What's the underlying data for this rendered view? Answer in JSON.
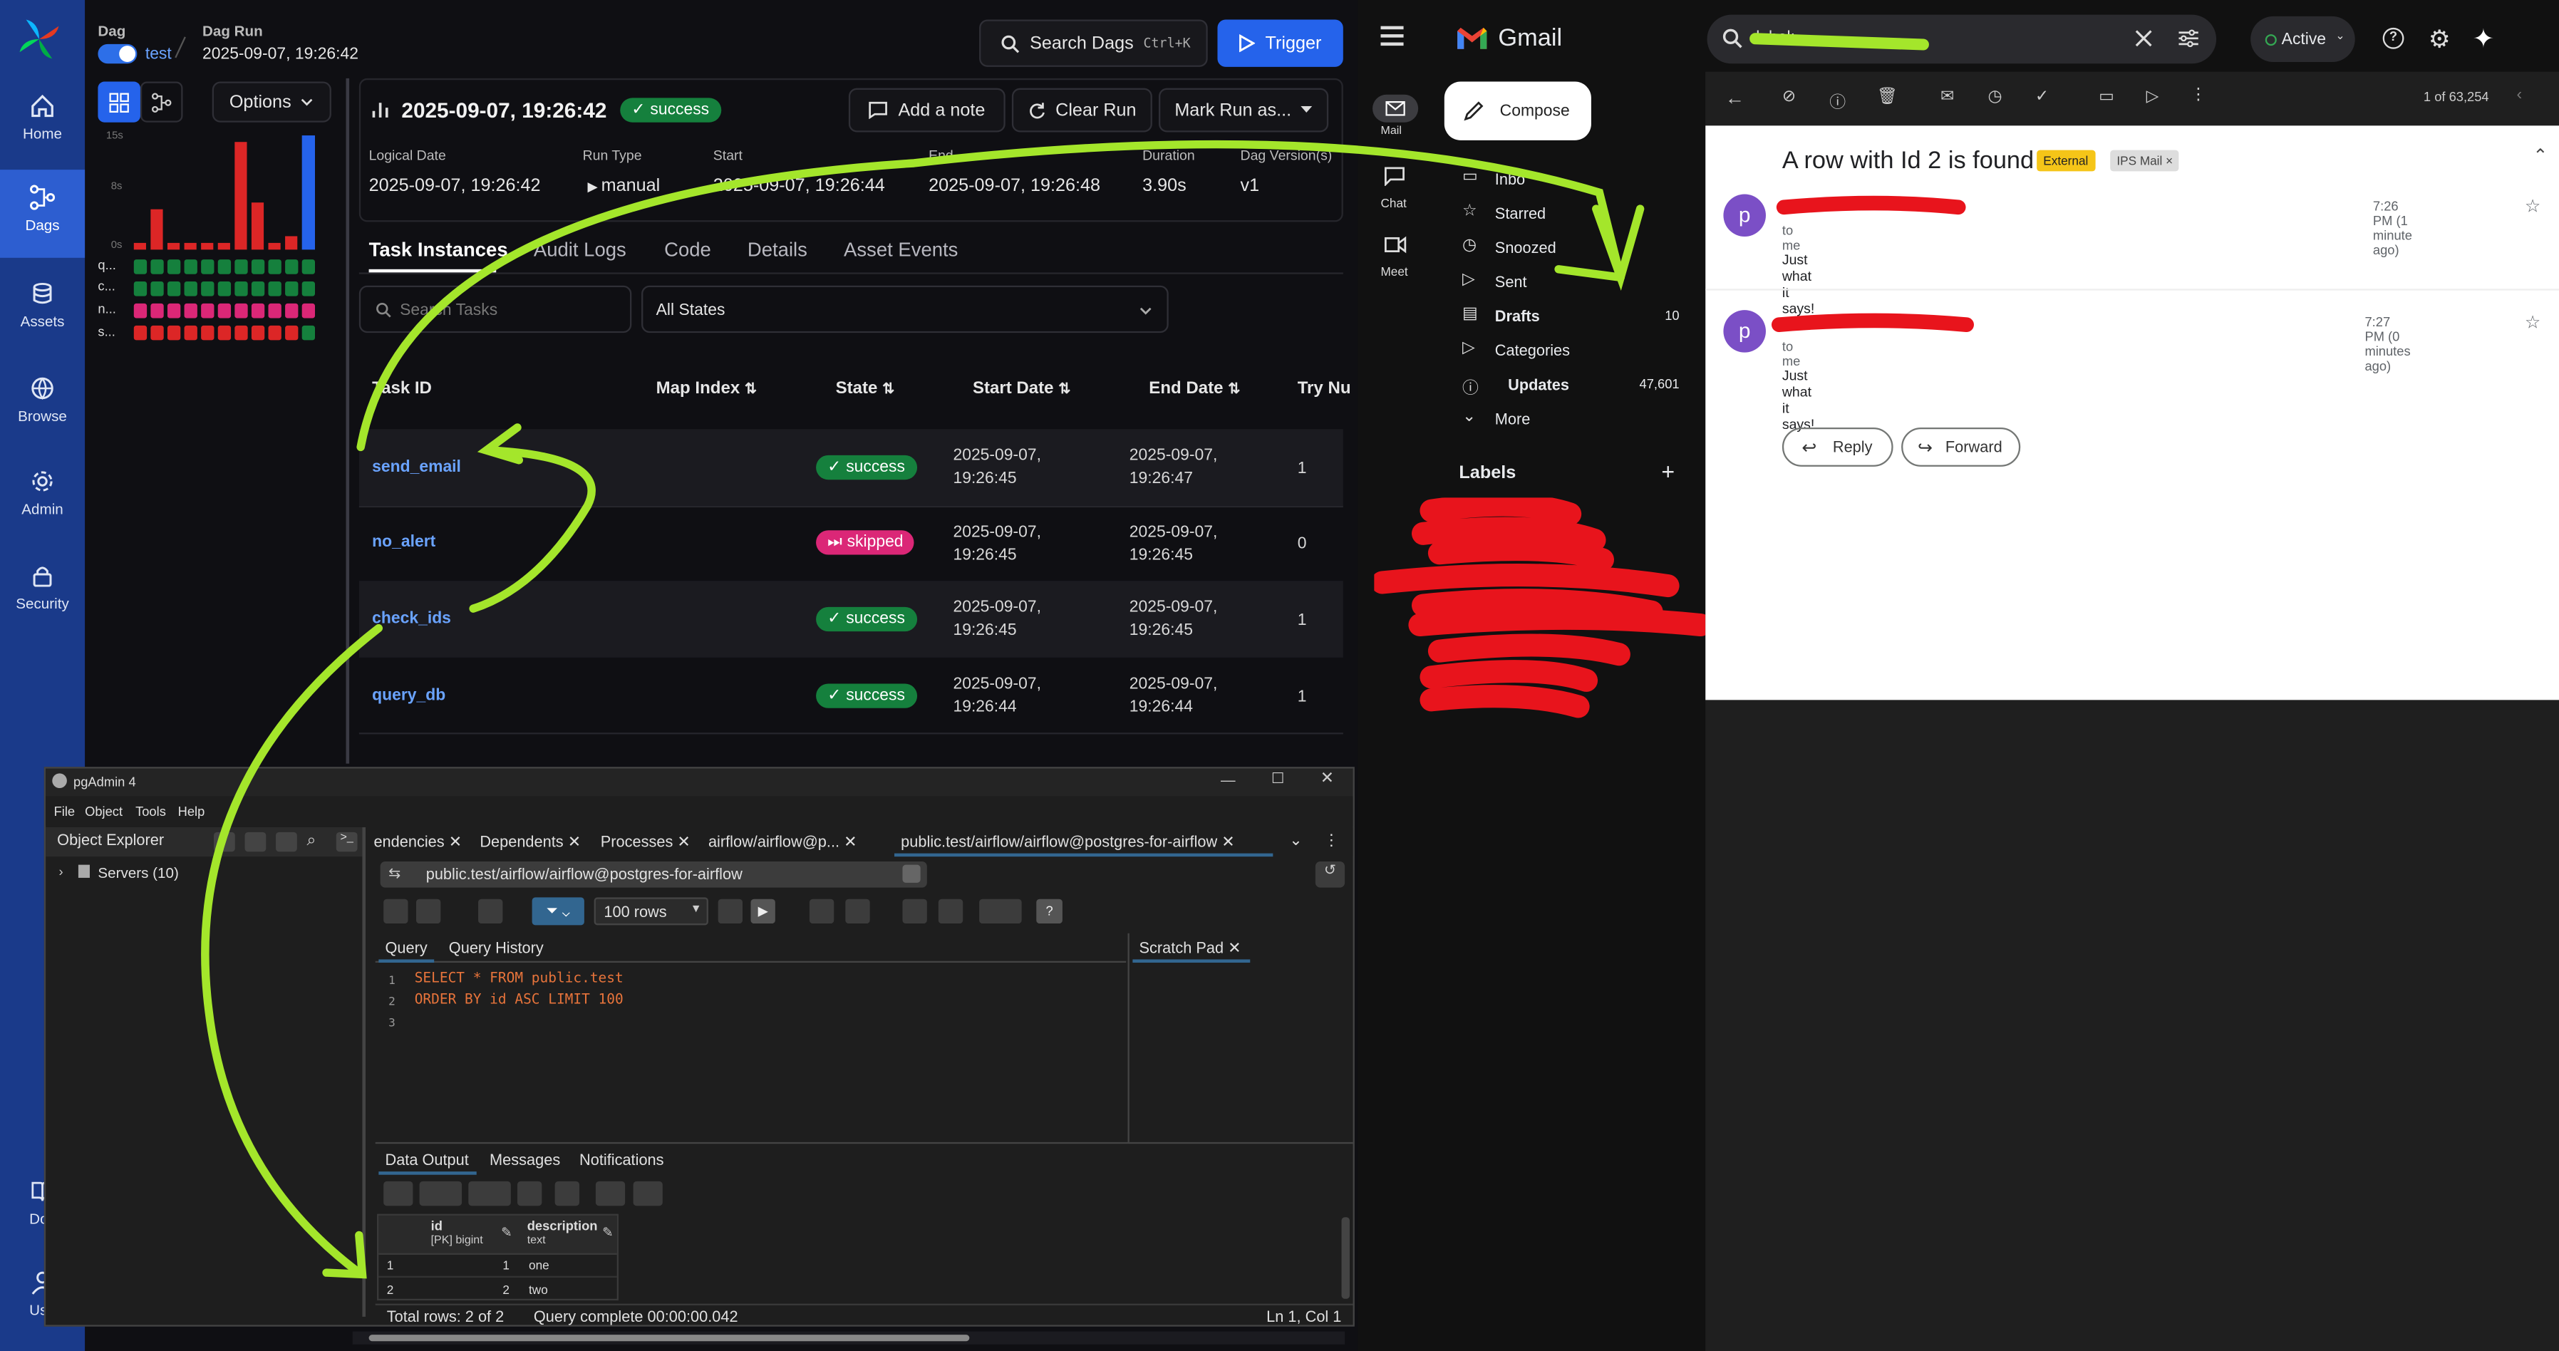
{
  "airflow": {
    "nav": [
      {
        "label": "Home",
        "icon": "home-icon"
      },
      {
        "label": "Dags",
        "icon": "dags-icon"
      },
      {
        "label": "Assets",
        "icon": "assets-icon"
      },
      {
        "label": "Browse",
        "icon": "browse-icon"
      },
      {
        "label": "Admin",
        "icon": "admin-icon"
      },
      {
        "label": "Security",
        "icon": "security-icon"
      },
      {
        "label": "Doc",
        "icon": "docs-icon"
      },
      {
        "label": "Use",
        "icon": "user-icon"
      }
    ],
    "breadcrumb": {
      "dag_label": "Dag",
      "dag_name": "test",
      "run_label": "Dag Run",
      "run_value": "2025-09-07, 19:26:42"
    },
    "search": {
      "label": "Search Dags",
      "shortcut": "Ctrl+K"
    },
    "trigger_label": "Trigger",
    "options_label": "Options",
    "grid": {
      "y_ticks": [
        "15s",
        "8s",
        "0s"
      ],
      "row_labels": [
        "q...",
        "c...",
        "n...",
        "s..."
      ],
      "bar_values": [
        1,
        6,
        1,
        1,
        1,
        1,
        16,
        7,
        1,
        2
      ],
      "accent_color": "#dc2626"
    },
    "run": {
      "title": "2025-09-07, 19:26:42",
      "status": "success",
      "add_note": "Add a note",
      "clear_run": "Clear Run",
      "mark_run": "Mark Run as...",
      "fields": [
        {
          "label": "Logical Date",
          "value": "2025-09-07, 19:26:42"
        },
        {
          "label": "Run Type",
          "value": "manual"
        },
        {
          "label": "Start",
          "value": "2025-09-07, 19:26:44"
        },
        {
          "label": "End",
          "value": "2025-09-07, 19:26:48"
        },
        {
          "label": "Duration",
          "value": "3.90s"
        },
        {
          "label": "Dag Version(s)",
          "value": "v1"
        }
      ]
    },
    "tabs": [
      "Task Instances",
      "Audit Logs",
      "Code",
      "Details",
      "Asset Events"
    ],
    "filter": {
      "search_placeholder": "Search Tasks",
      "state": "All States"
    },
    "columns": [
      "Task ID",
      "Map Index",
      "State",
      "Start Date",
      "End Date",
      "Try Nu"
    ],
    "tasks": [
      {
        "id": "send_email",
        "state": "success",
        "start": "2025-09-07,\n19:26:45",
        "end": "2025-09-07,\n19:26:47",
        "try": "1"
      },
      {
        "id": "no_alert",
        "state": "skipped",
        "start": "2025-09-07,\n19:26:45",
        "end": "2025-09-07,\n19:26:45",
        "try": "0"
      },
      {
        "id": "check_ids",
        "state": "success",
        "start": "2025-09-07,\n19:26:45",
        "end": "2025-09-07,\n19:26:45",
        "try": "1"
      },
      {
        "id": "query_db",
        "state": "success",
        "start": "2025-09-07,\n19:26:44",
        "end": "2025-09-07,\n19:26:44",
        "try": "1"
      }
    ]
  },
  "pgadmin": {
    "title": "pgAdmin 4",
    "menu": [
      "File",
      "Object",
      "Tools",
      "Help"
    ],
    "explorer_title": "Object Explorer",
    "tree_item": "Servers (10)",
    "tabs": [
      "endencies",
      "Dependents",
      "Processes",
      "airflow/airflow@p...",
      "public.test/airflow/airflow@postgres-for-airflow"
    ],
    "connection": "public.test/airflow/airflow@postgres-for-airflow",
    "rows_limit": "100 rows",
    "editor_tabs": [
      "Query",
      "Query History"
    ],
    "scratch_pad": "Scratch Pad",
    "query_lines": [
      "SELECT * FROM public.test",
      "ORDER BY id ASC LIMIT 100",
      ""
    ],
    "output_tabs": [
      "Data Output",
      "Messages",
      "Notifications"
    ],
    "columns": [
      {
        "name": "id",
        "type": "[PK] bigint"
      },
      {
        "name": "description",
        "type": "text"
      }
    ],
    "rows": [
      {
        "n": "1",
        "id": "1",
        "description": "one"
      },
      {
        "n": "2",
        "id": "2",
        "description": "two"
      }
    ],
    "status": {
      "total": "Total rows: 2 of 2",
      "complete": "Query complete 00:00:00.042",
      "position": "Ln 1, Col 1"
    }
  },
  "gmail": {
    "brand": "Gmail",
    "search_value": "label:",
    "status": "Active",
    "rail": [
      {
        "label": "Mail",
        "icon": "mail-icon"
      },
      {
        "label": "Chat",
        "icon": "chat-icon"
      },
      {
        "label": "Meet",
        "icon": "meet-icon"
      }
    ],
    "compose": "Compose",
    "folders": [
      {
        "label": "Inbo",
        "count": ""
      },
      {
        "label": "Starred",
        "count": ""
      },
      {
        "label": "Snoozed",
        "count": ""
      },
      {
        "label": "Sent",
        "count": ""
      },
      {
        "label": "Drafts",
        "count": "10"
      },
      {
        "label": "Categories",
        "count": ""
      },
      {
        "label": "Updates",
        "count": "47,601"
      },
      {
        "label": "More",
        "count": ""
      }
    ],
    "labels_title": "Labels",
    "pager": "1 of 63,254",
    "subject": "A row with Id 2 is found",
    "tags": [
      "External",
      "IPS Mail"
    ],
    "messages": [
      {
        "avatar": "p",
        "to": "to me",
        "time": "7:26 PM (1 minute ago)",
        "body": "Just what it says!"
      },
      {
        "avatar": "p",
        "to": "to me",
        "time": "7:27 PM (0 minutes ago)",
        "body": "Just what it says!"
      }
    ],
    "reply": "Reply",
    "forward": "Forward"
  },
  "colors": {
    "annotation": "#a4e62b",
    "redaction": "#e8141c",
    "success": "#15803d",
    "skipped": "#db2777",
    "airflow_nav": "#1a3a8a"
  }
}
